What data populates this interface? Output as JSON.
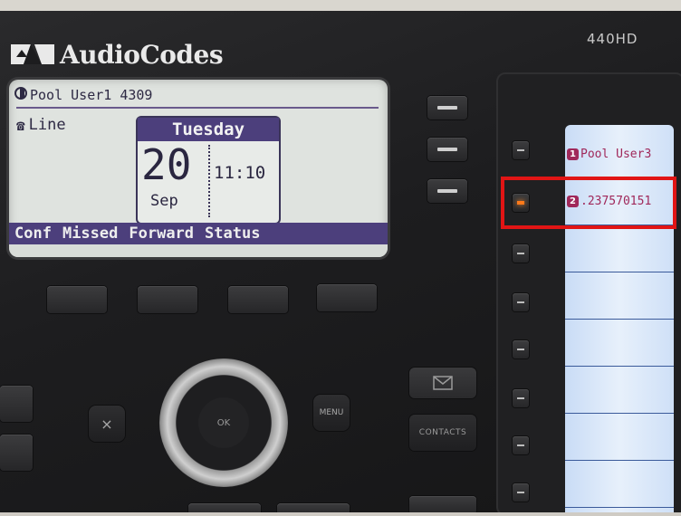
{
  "brand": {
    "name": "AudioCodes",
    "model": "440HD"
  },
  "lcd": {
    "header": "Pool User1 4309",
    "line_label": "Line",
    "clock": {
      "day": "Tuesday",
      "date": "20",
      "month": "Sep",
      "time": "11:10"
    },
    "softkeys": [
      "Conf",
      "Missed",
      "Forward",
      "Status"
    ]
  },
  "nav": {
    "ok_label": "OK",
    "menu_label": "MENU",
    "cancel_label": "×"
  },
  "contacts_label": "CONTACTS",
  "bls_keys": [
    {
      "number": "1",
      "label": "Pool User3",
      "led": "off"
    },
    {
      "number": "2",
      "label": ".237570151",
      "led": "orange"
    }
  ],
  "colors": {
    "led_active": "#ff7a1a",
    "highlight": "#e11515",
    "softkey_bar": "#4c3f7c",
    "bls_label": "#a0285a"
  }
}
